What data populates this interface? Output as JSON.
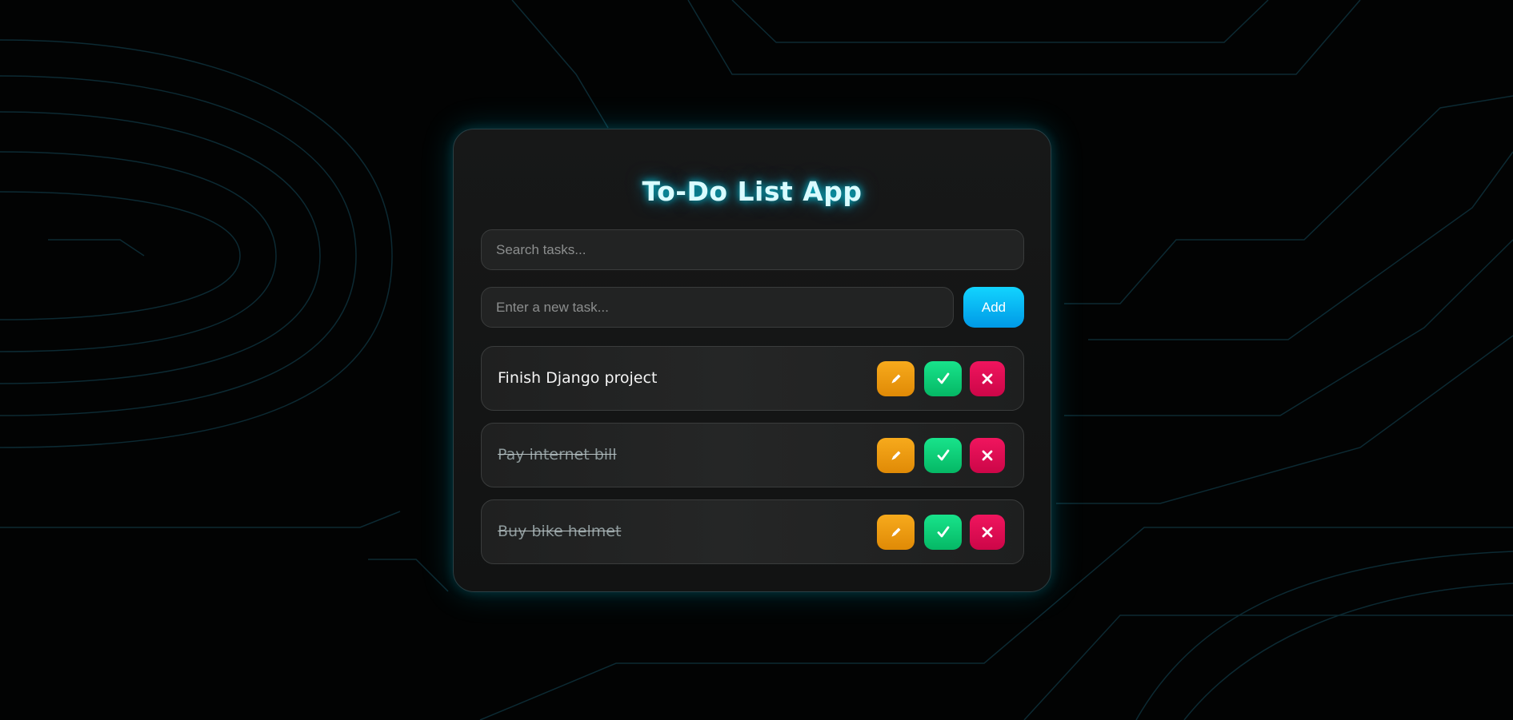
{
  "app": {
    "title": "To-Do List App"
  },
  "search": {
    "placeholder": "Search tasks..."
  },
  "new_task": {
    "placeholder": "Enter a new task...",
    "add_label": "Add"
  },
  "tasks": [
    {
      "text": "Finish Django project",
      "completed": false
    },
    {
      "text": "Pay internet bill",
      "completed": true
    },
    {
      "text": "Buy bike helmet",
      "completed": true
    }
  ],
  "icons": {
    "edit": "pencil-icon",
    "complete": "check-icon",
    "delete": "close-icon"
  },
  "colors": {
    "accent": "#00d4ff",
    "edit": "#f2a012",
    "complete": "#0fd67a",
    "delete": "#e60d55"
  }
}
